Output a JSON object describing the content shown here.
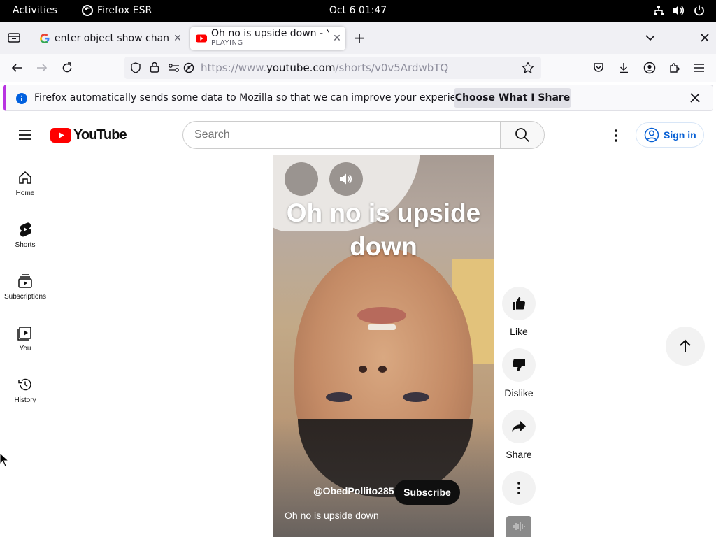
{
  "system_bar": {
    "activities": "Activities",
    "app_name": "Firefox ESR",
    "clock": "Oct 6  01:47"
  },
  "browser": {
    "tabs": [
      {
        "title": "enter object show channe",
        "favicon": "google-icon",
        "active": false
      },
      {
        "title": "Oh no is upside down - Yo",
        "subtitle": "PLAYING",
        "favicon": "youtube-icon",
        "active": true
      }
    ],
    "url": {
      "prefix": "https://www.",
      "domain": "youtube.com",
      "path": "/shorts/v0v5ArdwbTQ"
    }
  },
  "notification": {
    "message": "Firefox automatically sends some data to Mozilla so that we can improve your experience.",
    "button": "Choose What I Share"
  },
  "youtube": {
    "logo_text": "YouTube",
    "search_placeholder": "Search",
    "sign_in": "Sign in",
    "sidebar": [
      {
        "label": "Home",
        "icon": "home-icon"
      },
      {
        "label": "Shorts",
        "icon": "shorts-icon"
      },
      {
        "label": "Subscriptions",
        "icon": "subscriptions-icon"
      },
      {
        "label": "You",
        "icon": "you-icon"
      },
      {
        "label": "History",
        "icon": "history-icon"
      }
    ],
    "short": {
      "overlay_title": "Oh no is upside down",
      "channel": "@ObedPollito285",
      "subscribe": "Subscribe",
      "caption": "Oh no is upside down"
    },
    "actions": {
      "like": "Like",
      "dislike": "Dislike",
      "share": "Share"
    }
  },
  "colors": {
    "youtube_red": "#ff0000",
    "link_blue": "#065fd4",
    "notification_accent": "#b833e1"
  }
}
